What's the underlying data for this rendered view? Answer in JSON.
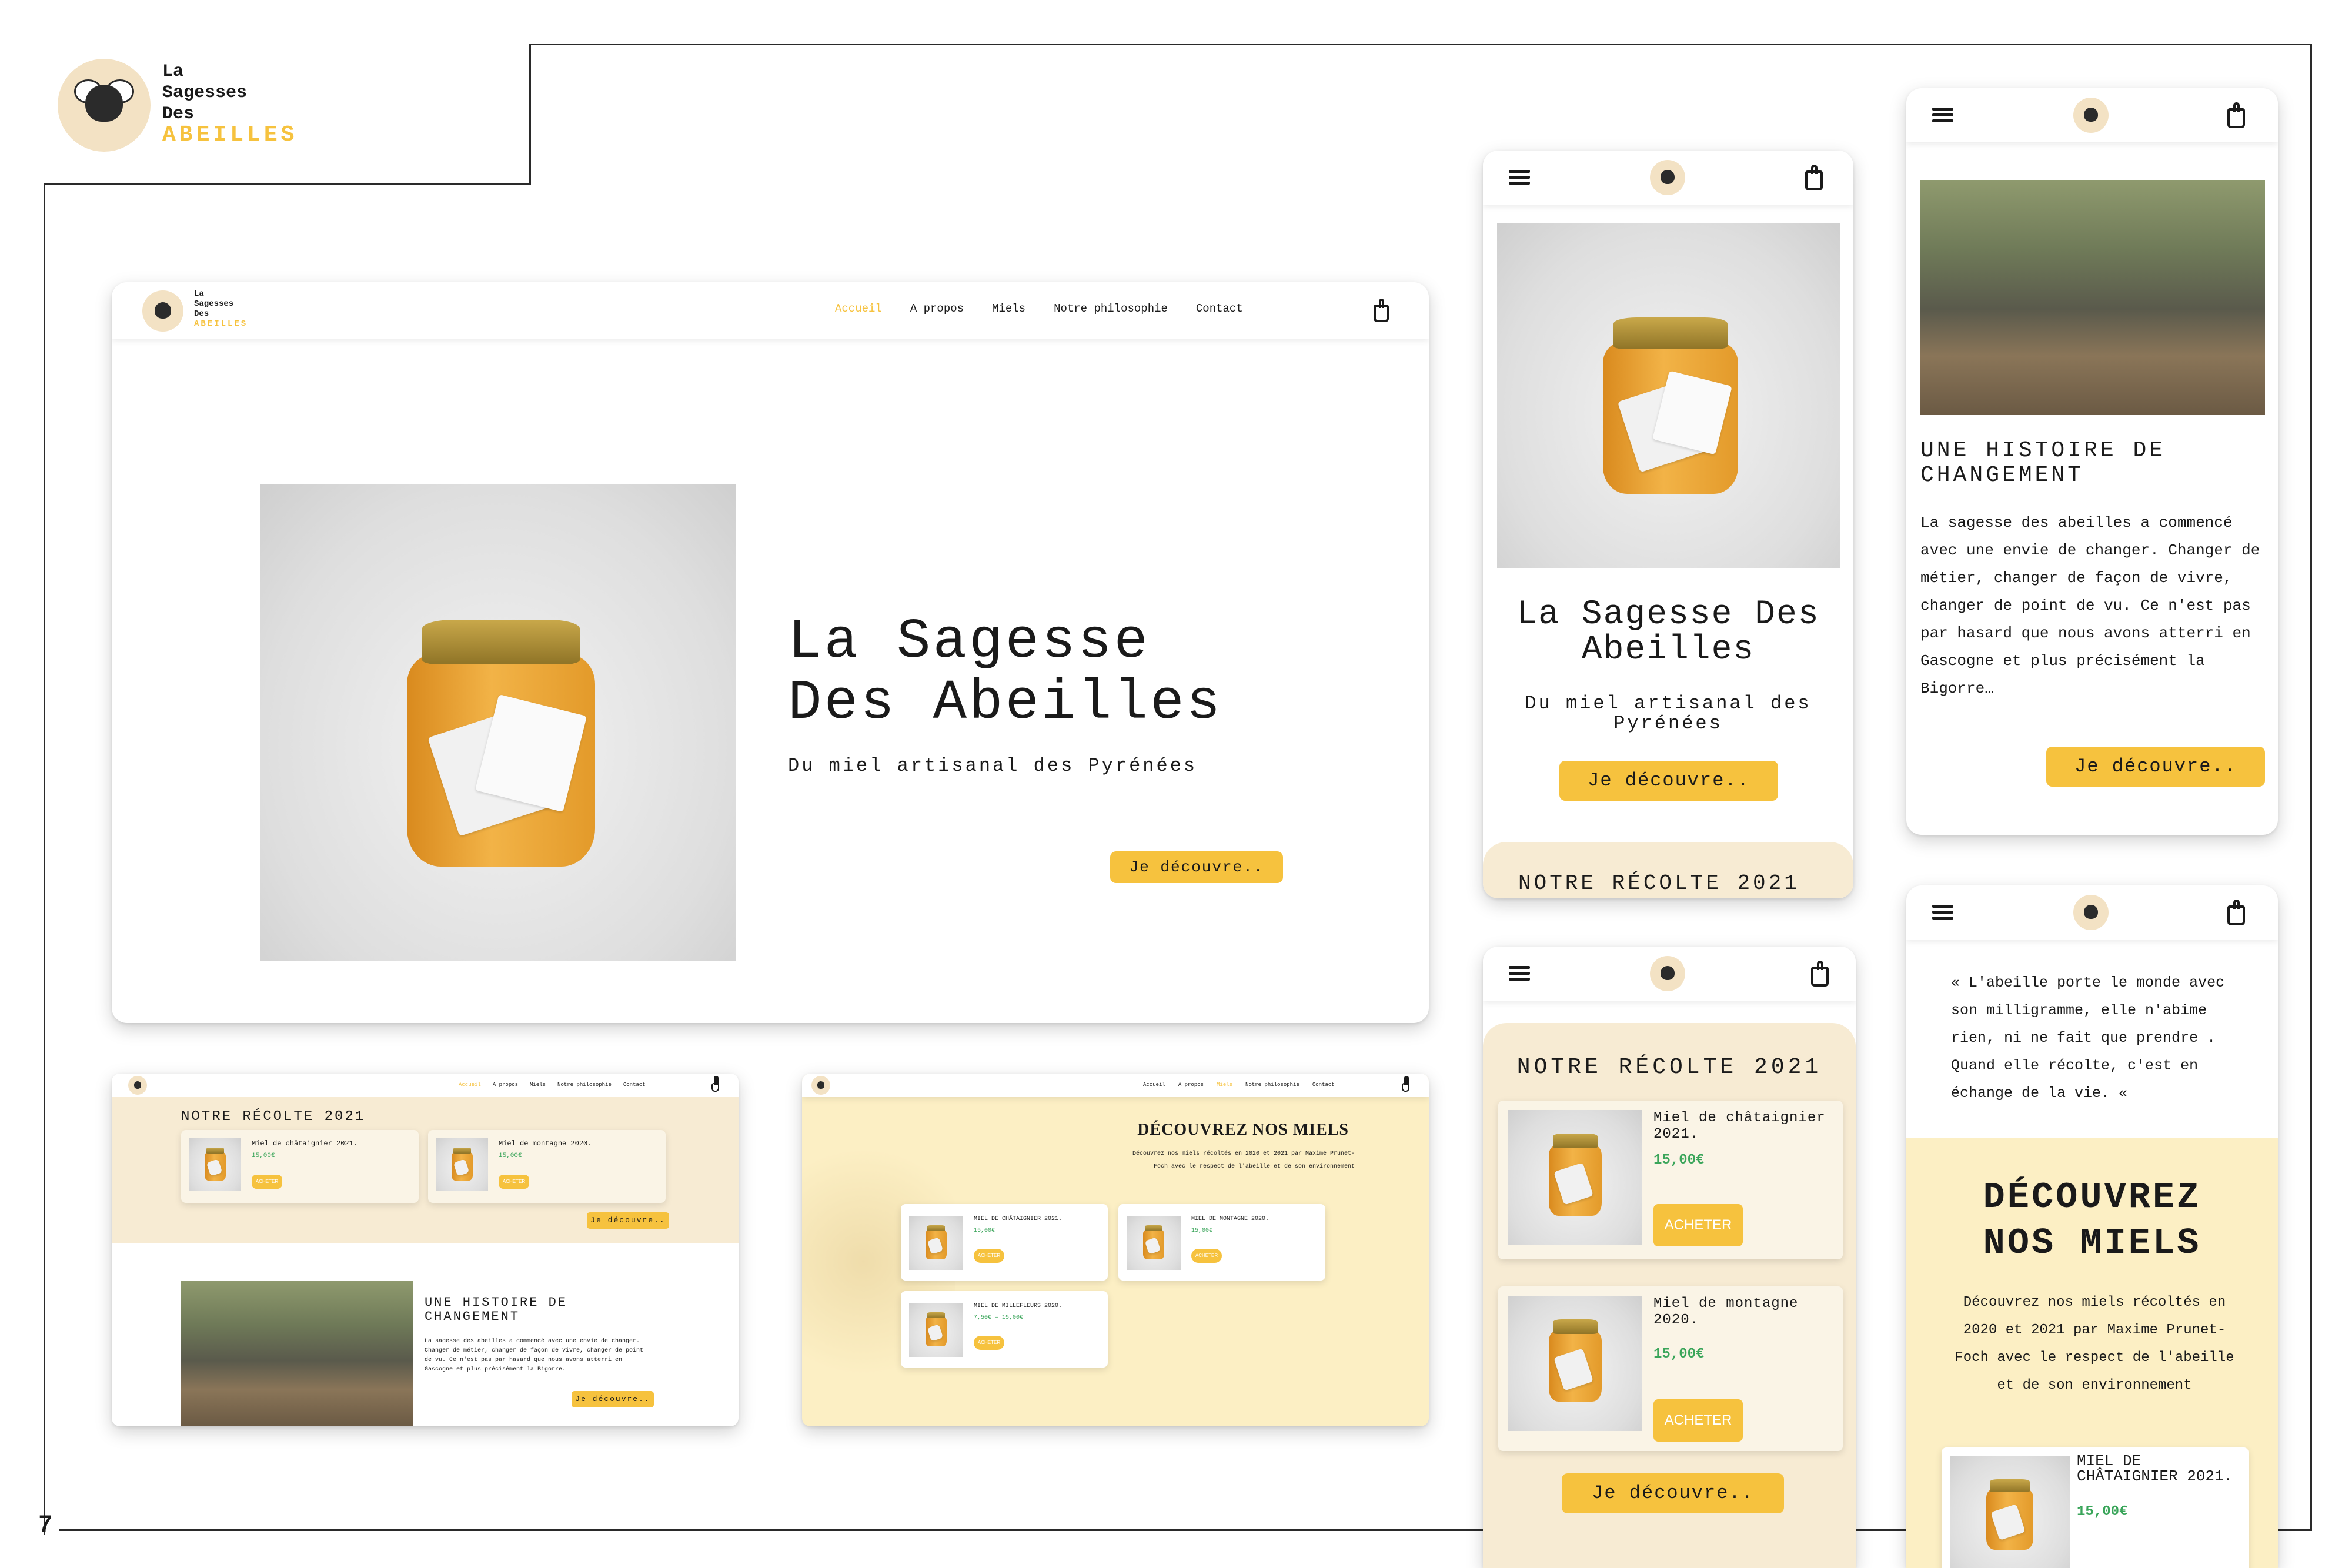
{
  "brand": {
    "line1": "La",
    "line2": "Sagesses",
    "line3": "Des",
    "line4": "ABEILLES"
  },
  "page_number": "7",
  "colors": {
    "accent": "#f6c23e",
    "cream": "#f7ebd3",
    "yellow_bg": "#fcefc4",
    "price_green": "#3aa55a"
  },
  "desktop": {
    "nav": [
      "Accueil",
      "A propos",
      "Miels",
      "Notre philosophie",
      "Contact"
    ],
    "hero_title_1": "La Sagesse",
    "hero_title_2": "Des Abeilles",
    "hero_subtitle": "Du miel artisanal des Pyrénées",
    "hero_button": "Je découvre.."
  },
  "harvest_page": {
    "title": "NOTRE RÉCOLTE 2021",
    "products": [
      {
        "name": "Miel de châtaignier 2021.",
        "price": "15,00€",
        "button": "ACHETER"
      },
      {
        "name": "Miel de montagne 2020.",
        "price": "15,00€",
        "button": "ACHETER"
      }
    ],
    "button": "Je découvre..",
    "story_title": "UNE HISTOIRE DE CHANGEMENT",
    "story_text": "La sagesse des abeilles a commencé avec une envie de changer. Changer de métier, changer de façon de vivre, changer de point de vu. Ce n'est pas par hasard que nous avons atterri en Gascogne et plus précisément la Bigorre.",
    "story_button": "Je découvre.."
  },
  "miels_page": {
    "title": "DÉCOUVREZ NOS MIELS",
    "text": "Découvrez nos miels récoltés en 2020 et 2021 par Maxime Prunet-Foch avec le respect de l'abeille et de son environnement",
    "products": [
      {
        "name": "MIEL DE CHÂTAIGNIER 2021.",
        "price": "15,00€",
        "button": "ACHETER"
      },
      {
        "name": "MIEL DE MONTAGNE 2020.",
        "price": "15,00€",
        "button": "ACHETER"
      },
      {
        "name": "MIEL DE MILLEFLEURS 2020.",
        "price": "7,50€ – 15,00€",
        "button": "ACHETER"
      }
    ]
  },
  "mobile_hero": {
    "title": "La Sagesse Des Abeilles",
    "subtitle": "Du miel artisanal des Pyrénées",
    "button": "Je découvre..",
    "peek_title": "NOTRE RÉCOLTE 2021"
  },
  "mobile_story": {
    "title": "UNE HISTOIRE DE CHANGEMENT",
    "text": "La sagesse des abeilles a commencé avec une envie de changer. Changer de métier, changer de façon de vivre, changer de point de vu. Ce n'est pas par hasard que nous avons atterri en Gascogne et plus précisément la Bigorre…",
    "button": "Je découvre.."
  },
  "mobile_harvest": {
    "title": "NOTRE RÉCOLTE 2021",
    "products": [
      {
        "name": "Miel de châtaignier 2021.",
        "price": "15,00€",
        "button": "ACHETER"
      },
      {
        "name": "Miel de montagne 2020.",
        "price": "15,00€",
        "button": "ACHETER"
      }
    ],
    "button": "Je découvre.."
  },
  "mobile_quote": {
    "quote": "« L'abeille porte le monde avec son milligramme, elle n'abime rien, ni ne fait que prendre . Quand elle récolte, c'est en échange de la vie. «",
    "title_1": "DÉCOUVREZ",
    "title_2": "NOS MIELS",
    "text": "Découvrez nos miels récoltés en 2020 et 2021 par Maxime Prunet-Foch avec le respect de l'abeille et de son environnement",
    "product": {
      "name": "MIEL DE CHÂTAIGNIER 2021.",
      "price": "15,00€"
    }
  }
}
